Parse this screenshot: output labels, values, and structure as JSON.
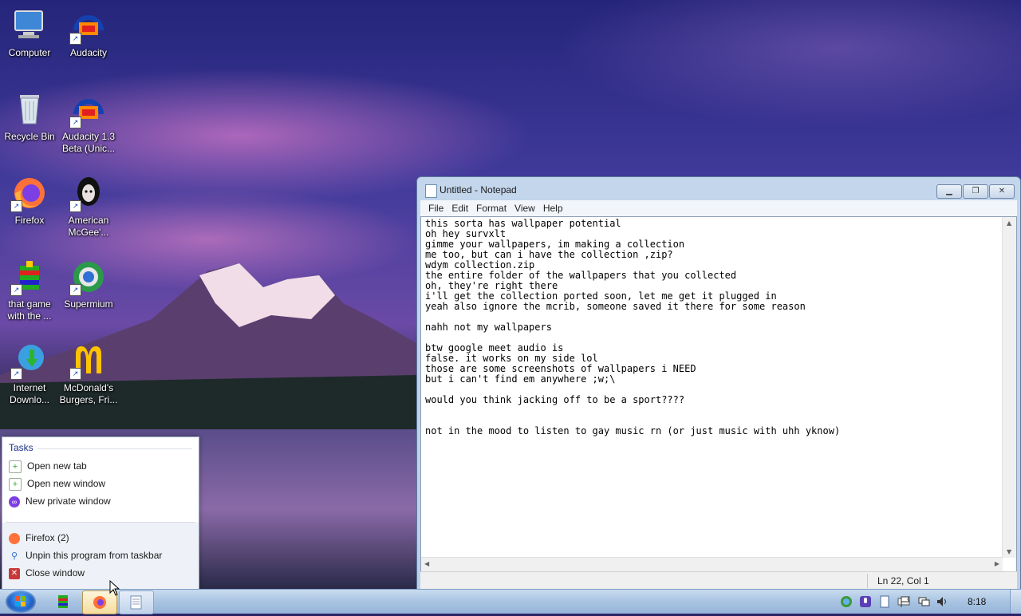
{
  "desktop": {
    "icons": [
      {
        "label": "Computer",
        "icon": "computer-icon"
      },
      {
        "label": "Audacity",
        "icon": "audacity-icon"
      },
      {
        "label": "Recycle Bin",
        "icon": "recycle-bin-icon"
      },
      {
        "label": "Audacity 1.3 Beta (Unic...",
        "icon": "audacity-icon"
      },
      {
        "label": "Firefox",
        "icon": "firefox-icon"
      },
      {
        "label": "American McGee'...",
        "icon": "game-icon"
      },
      {
        "label": "that game with the ...",
        "icon": "game-icon"
      },
      {
        "label": "Supermium",
        "icon": "browser-icon"
      },
      {
        "label": "Internet Downlo...",
        "icon": "download-manager-icon"
      },
      {
        "label": "McDonald's Burgers, Fri...",
        "icon": "mcdonalds-icon"
      }
    ]
  },
  "jumplist": {
    "header": "Tasks",
    "tasks": [
      "Open new tab",
      "Open new window",
      "New private window"
    ],
    "program": "Firefox (2)",
    "unpin": "Unpin this program from taskbar",
    "close": "Close window"
  },
  "notepad": {
    "title": "Untitled - Notepad",
    "menu": [
      "File",
      "Edit",
      "Format",
      "View",
      "Help"
    ],
    "lines": [
      "this sorta has wallpaper potential",
      "oh hey survxlt",
      "gimme your wallpapers, im making a collection",
      "me too, but can i have the collection ,zip?",
      "wdym collection.zip",
      "the entire folder of the wallpapers that you collected",
      "oh, they're right there",
      "i'll get the collection ported soon, let me get it plugged in",
      "yeah also ignore the mcrib, someone saved it there for some reason",
      "",
      "nahh not my wallpapers",
      "",
      "btw google meet audio is",
      "false. it works on my side lol",
      "those are some screenshots of wallpapers i NEED",
      "but i can't find em anywhere ;w;\\",
      "",
      "would you think jacking off to be a sport????",
      "",
      "",
      "not in the mood to listen to gay music rn (or just music with uhh yknow)"
    ],
    "status_position": "Ln 22, Col 1"
  },
  "taskbar": {
    "clock": "8:18",
    "pinned": [
      "game-icon",
      "firefox-icon",
      "notepad-icon"
    ]
  },
  "colors": {
    "jumplist_header": "#1e3287",
    "taskbar": "#a9c4e2",
    "notepad_frame": "#c3d6ec"
  }
}
